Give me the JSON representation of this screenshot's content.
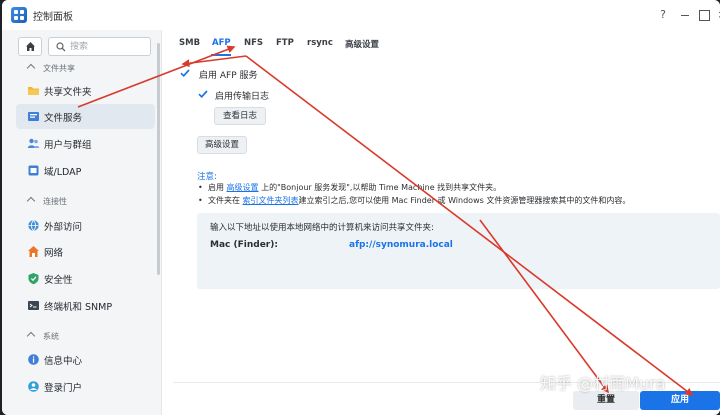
{
  "window": {
    "title": "控制面板"
  },
  "titlebar": {
    "help": "?",
    "close": "×"
  },
  "search": {
    "placeholder": "搜索"
  },
  "sidebar": {
    "groups": [
      {
        "label": "文件共享"
      },
      {
        "label": "连接性"
      },
      {
        "label": "系统"
      }
    ],
    "items": [
      {
        "label": "共享文件夹",
        "icon": "folder-icon"
      },
      {
        "label": "文件服务",
        "icon": "file-services-icon"
      },
      {
        "label": "用户与群组",
        "icon": "users-icon"
      },
      {
        "label": "域/LDAP",
        "icon": "domain-icon"
      },
      {
        "label": "外部访问",
        "icon": "globe-icon"
      },
      {
        "label": "网络",
        "icon": "network-icon"
      },
      {
        "label": "安全性",
        "icon": "shield-icon"
      },
      {
        "label": "终端机和 SNMP",
        "icon": "terminal-icon"
      },
      {
        "label": "信息中心",
        "icon": "info-icon"
      },
      {
        "label": "登录门户",
        "icon": "portal-icon"
      }
    ]
  },
  "tabs": [
    {
      "label": "SMB"
    },
    {
      "label": "AFP"
    },
    {
      "label": "NFS"
    },
    {
      "label": "FTP"
    },
    {
      "label": "rsync"
    },
    {
      "label": "高级设置"
    }
  ],
  "afp": {
    "enable_label": "启用 AFP 服务",
    "log_label": "启用传输日志",
    "view_log_button": "查看日志",
    "advanced_button": "高级设置"
  },
  "notes": {
    "title": "注意:",
    "line1_prefix": "启用",
    "line1_link": "高级设置",
    "line1_suffix": "上的\"Bonjour 服务发现\",以帮助 Time Machine 找到共享文件夹。",
    "line2_prefix": "文件夹在",
    "line2_link": "索引文件夹列表",
    "line2_suffix": "建立索引之后,您可以使用 Mac Finder 或 Windows 文件资源管理器搜索其中的文件和内容。"
  },
  "info": {
    "text": "输入以下地址以使用本地网络中的计算机来访问共享文件夹:",
    "mac_label": "Mac (Finder):",
    "mac_value": "afp://synomura.local"
  },
  "footer": {
    "reset_button": "重置",
    "apply_button": "应用"
  },
  "watermark": "知乎 @村雨Mura",
  "colors": {
    "accent": "#1b73e8",
    "arrow": "#d93a2b"
  }
}
